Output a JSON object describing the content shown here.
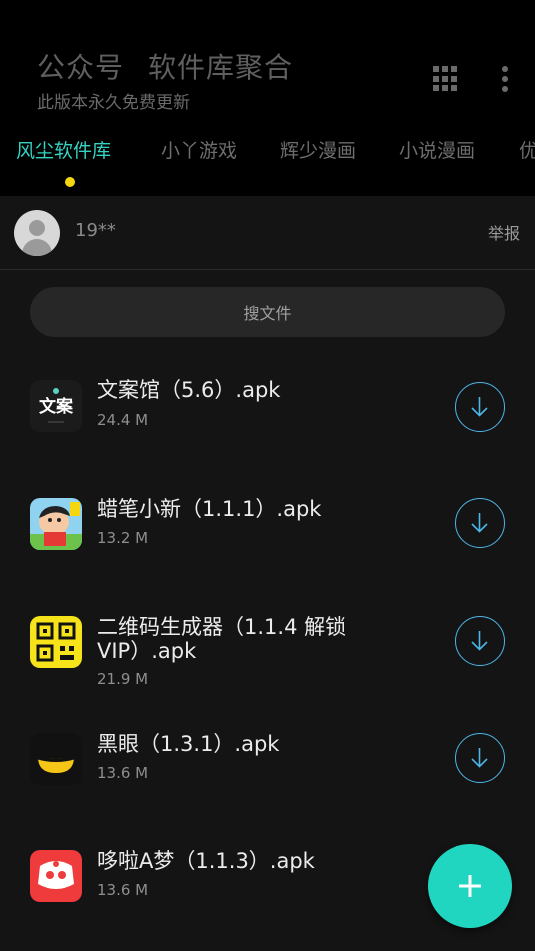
{
  "header": {
    "title_parts": [
      "公众号",
      "软件库聚合"
    ],
    "subtitle": "此版本永久免费更新",
    "grid_icon": "grid-icon",
    "more_icon": "more-vertical-icon"
  },
  "tabs": [
    {
      "label": "风尘软件库",
      "active": true
    },
    {
      "label": "小丫游戏",
      "active": false
    },
    {
      "label": "辉少漫画",
      "active": false
    },
    {
      "label": "小说漫画",
      "active": false
    },
    {
      "label": "优",
      "active": false
    }
  ],
  "user": {
    "name": "19**",
    "report_label": "举报"
  },
  "search": {
    "label": "搜文件"
  },
  "files": [
    {
      "name": "文案馆（5.6）.apk",
      "size": "24.4 M",
      "icon": "wenanguan-icon",
      "icon_text": "文案"
    },
    {
      "name": "蜡笔小新（1.1.1）.apk",
      "size": "13.2 M",
      "icon": "crayon-shinchan-icon"
    },
    {
      "name": "二维码生成器（1.1.4 解锁VIP）.apk",
      "size": "21.9 M",
      "icon": "qr-code-icon"
    },
    {
      "name": "黑眼（1.3.1）.apk",
      "size": "13.6 M",
      "icon": "black-eye-icon"
    },
    {
      "name": "哆啦A梦（1.1.3）.apk",
      "size": "13.6 M",
      "icon": "doraemon-icon"
    }
  ],
  "colors": {
    "accent": "#34d3c2",
    "indicator": "#f5d60f",
    "download_ring": "#4bb6e8",
    "fab": "#20d6c0"
  },
  "fab": {
    "icon": "plus-icon"
  }
}
